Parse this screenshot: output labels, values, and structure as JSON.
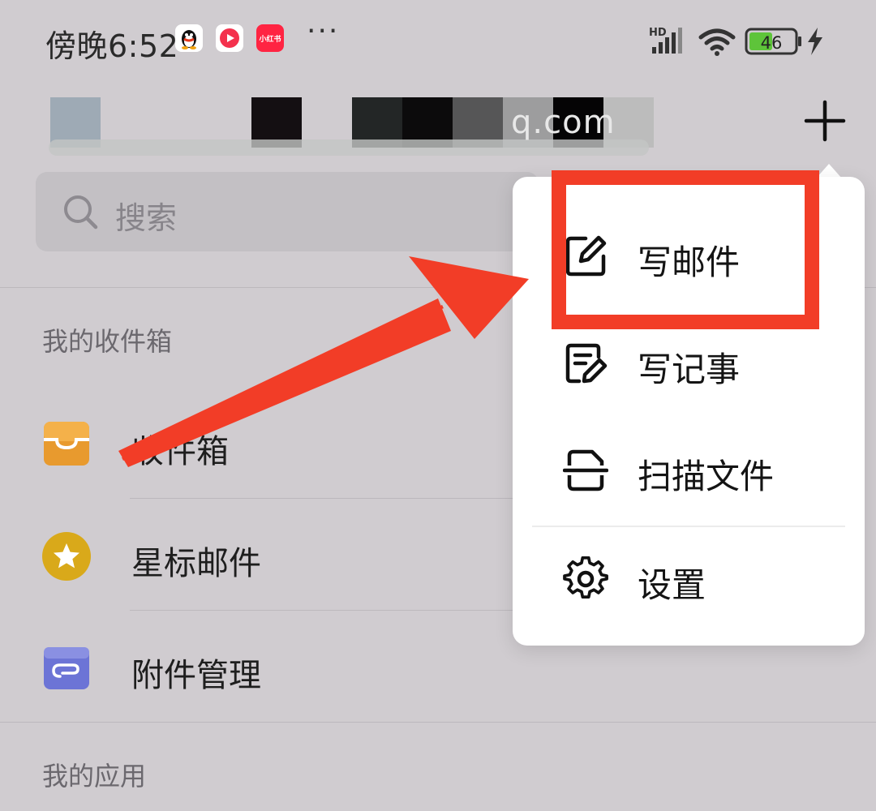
{
  "status_bar": {
    "time": "傍晚6:52",
    "badge_xhs": "小红书",
    "more_indicator": "···",
    "network_type": "HD",
    "battery_level": "46",
    "battery_color": "#5ec43a"
  },
  "header": {
    "account_tail": "q.com",
    "plus_icon": "plus-icon"
  },
  "search": {
    "placeholder": "搜索"
  },
  "sections": {
    "inbox_section_title": "我的收件箱",
    "apps_section_title": "我的应用"
  },
  "list": {
    "items": [
      {
        "label": "收件箱",
        "icon": "inbox-tray-icon",
        "color": "#e0902a"
      },
      {
        "label": "星标邮件",
        "icon": "star-icon",
        "color": "#e2b020"
      },
      {
        "label": "附件管理",
        "icon": "attachment-icon",
        "color": "#6f78d8"
      }
    ]
  },
  "menu": {
    "items": [
      {
        "label": "写邮件",
        "icon": "compose-icon"
      },
      {
        "label": "写记事",
        "icon": "note-icon"
      },
      {
        "label": "扫描文件",
        "icon": "scan-icon"
      },
      {
        "label": "设置",
        "icon": "gear-icon"
      }
    ]
  },
  "annotation": {
    "color": "#f23d27"
  }
}
